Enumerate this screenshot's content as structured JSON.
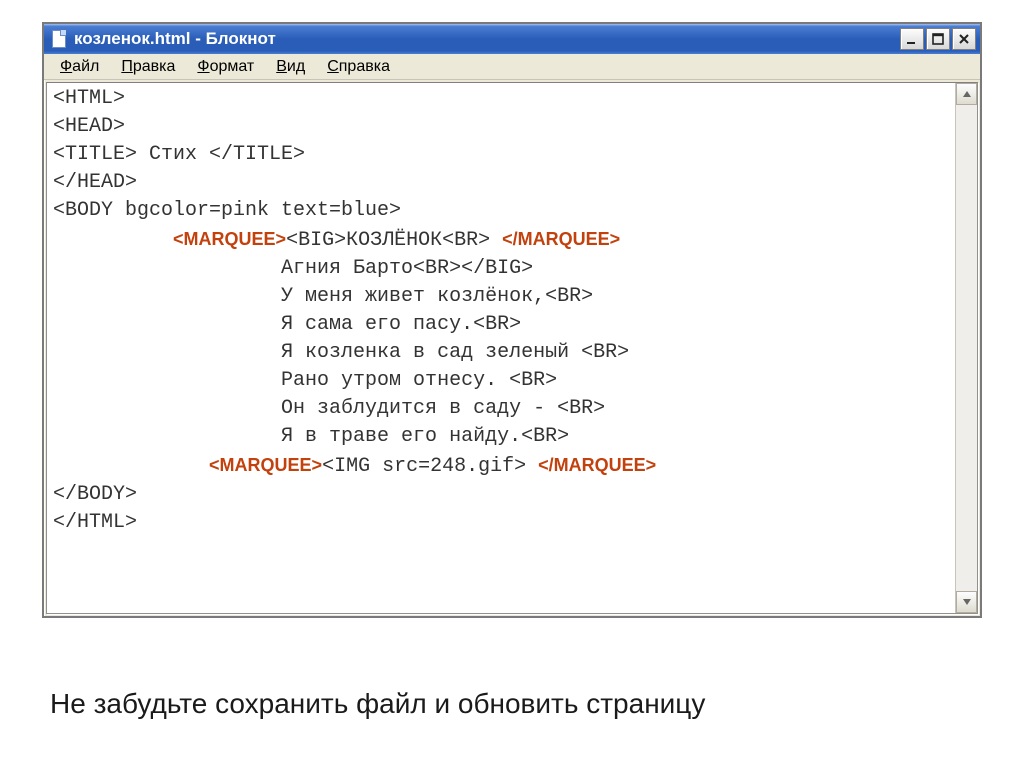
{
  "window": {
    "title": "козленок.html - Блокнот"
  },
  "menu": {
    "file": "Файл",
    "edit": "Правка",
    "format": "Формат",
    "view": "Вид",
    "help": "Справка"
  },
  "code": {
    "l1": "<HTML>",
    "l2": "<HEAD>",
    "l3": "<TITLE> Стих </TITLE>",
    "l4": "</HEAD>",
    "l5": "<BODY bgcolor=pink text=blue>",
    "l6_mid": "<BIG>КОЗЛЁНОК<BR>",
    "l7": "                   Агния Барто<BR></BIG>",
    "l8": "                   У меня живет козлёнок,<BR>",
    "l9": "                   Я сама его пасу.<BR>",
    "l10": "                   Я козленка в сад зеленый <BR>",
    "l11": "                   Рано утром отнесу. <BR>",
    "l12": "                   Он заблудится в саду - <BR>",
    "l13": "                   Я в траве его найду.<BR>",
    "l14_mid": "<IMG src=248.gif>",
    "l15": "</BODY>",
    "l16": "</HTML>"
  },
  "annotations": {
    "marquee_open": "<MARQUEE>",
    "marquee_close": "</MARQUEE>",
    "indent6": "          ",
    "indent14": "             "
  },
  "caption": "Не забудьте сохранить файл и обновить страницу"
}
